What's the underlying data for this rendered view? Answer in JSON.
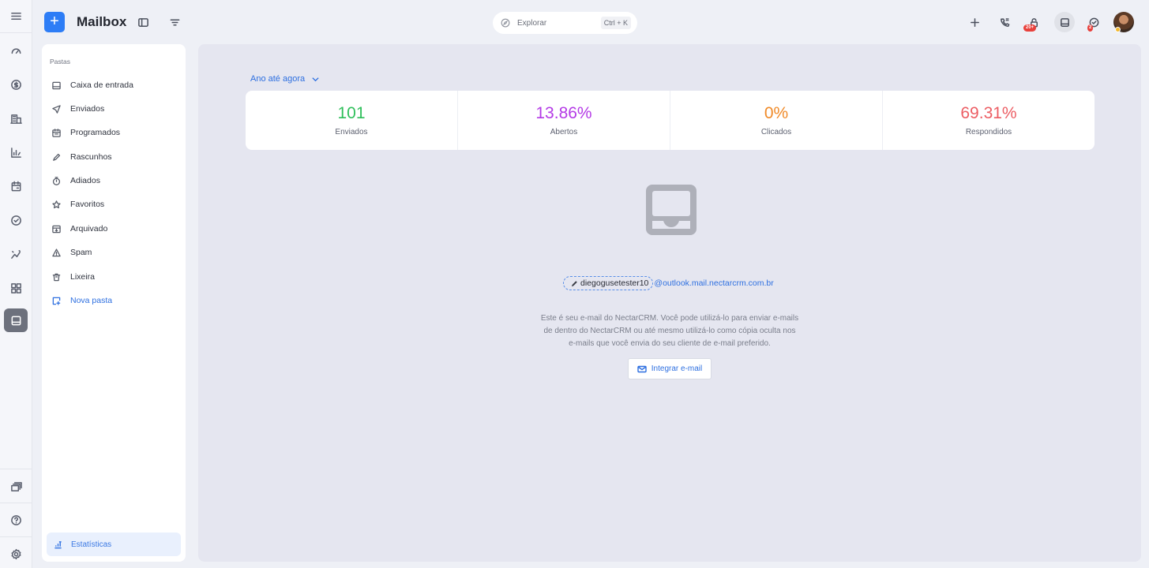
{
  "app": {
    "title": "Mailbox",
    "new_label": "+"
  },
  "search": {
    "placeholder": "Explorar",
    "shortcut": "Ctrl + K"
  },
  "header": {
    "notifications_badge": "20+",
    "tasks_badge": "2"
  },
  "folders": {
    "heading": "Pastas",
    "items": [
      {
        "label": "Caixa de entrada",
        "icon": "inbox-icon"
      },
      {
        "label": "Enviados",
        "icon": "send-icon"
      },
      {
        "label": "Programados",
        "icon": "calendar-icon"
      },
      {
        "label": "Rascunhos",
        "icon": "pencil-icon"
      },
      {
        "label": "Adiados",
        "icon": "timer-icon"
      },
      {
        "label": "Favoritos",
        "icon": "star-icon"
      },
      {
        "label": "Arquivado",
        "icon": "archive-icon"
      },
      {
        "label": "Spam",
        "icon": "warning-icon"
      },
      {
        "label": "Lixeira",
        "icon": "trash-icon"
      },
      {
        "label": "Nova pasta",
        "icon": "new-folder-icon"
      }
    ],
    "stats_label": "Estatísticas"
  },
  "main": {
    "range_label": "Ano até agora",
    "stats": [
      {
        "value": "101",
        "label": "Enviados",
        "color": "#2fbf5b"
      },
      {
        "value": "13.86%",
        "label": "Abertos",
        "color": "#b43ae6"
      },
      {
        "value": "0%",
        "label": "Clicados",
        "color": "#f08a28"
      },
      {
        "value": "69.31%",
        "label": "Respondidos",
        "color": "#ec5d63"
      }
    ],
    "email_user": "diegogusetester10",
    "email_domain": "@outlook.mail.nectarcrm.com.br",
    "description": "Este é seu e-mail do NectarCRM. Você pode utilizá-lo para enviar e-mails de dentro do NectarCRM ou até mesmo utilizá-lo como cópia oculta nos e-mails que você envia do seu cliente de e-mail preferido.",
    "integrate_label": "Integrar e-mail"
  }
}
